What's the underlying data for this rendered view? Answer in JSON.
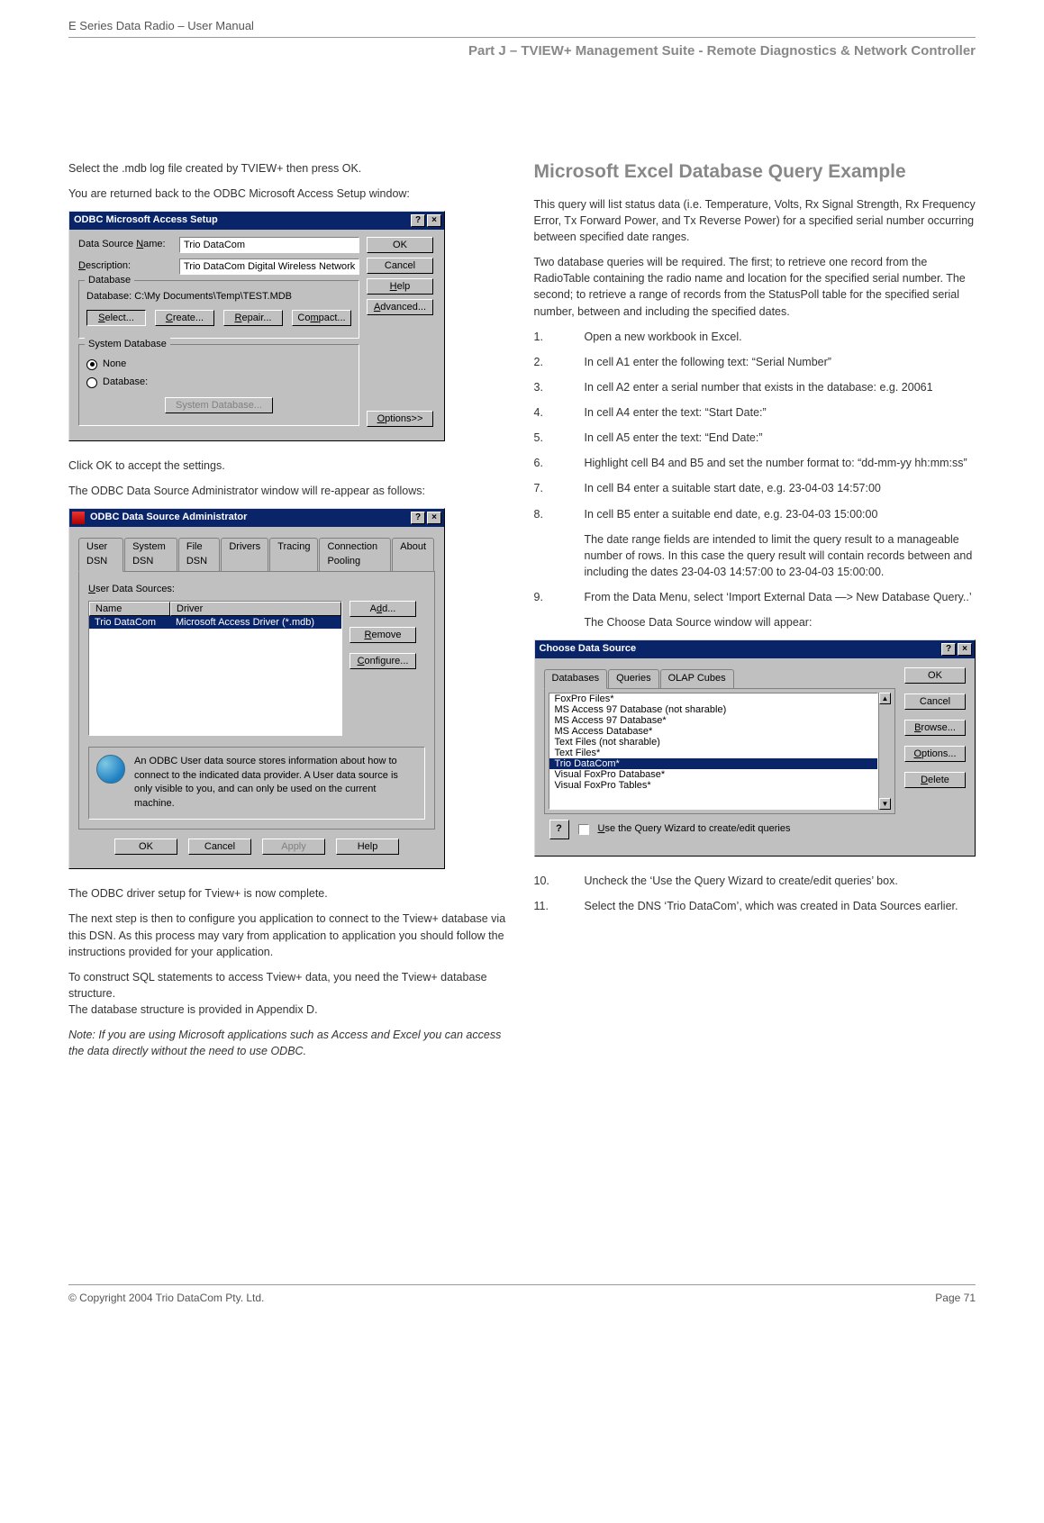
{
  "header": {
    "doc_title": "E Series Data Radio – User Manual",
    "section_title": "Part J – TVIEW+ Management Suite -  Remote Diagnostics & Network Controller"
  },
  "left": {
    "p1": "Select the .mdb log file created by TVIEW+ then press OK.",
    "p2": "You are returned back to the ODBC Microsoft Access Setup window:",
    "p3": "Click OK to accept the settings.",
    "p4": "The ODBC Data Source Administrator window will re-appear as follows:",
    "p5": "The ODBC driver setup for Tview+ is now complete.",
    "p6": "The next step is then to configure you application to connect to the Tview+ database via this DSN.  As this process may vary from application to application you should follow the instructions provided for your application.",
    "p7": "To construct SQL statements to access Tview+ data, you need the Tview+ database structure.",
    "p8": "The database structure is provided in Appendix D.",
    "p9": "Note: If you are using Microsoft applications such as Access and Excel you can access the data directly without the need to use ODBC."
  },
  "dlg1": {
    "title": "ODBC Microsoft Access Setup",
    "help_glyph": "?",
    "close_glyph": "×",
    "lbl_dsn": "Data Source Name:",
    "val_dsn": "Trio DataCom",
    "lbl_desc": "Description:",
    "val_desc": "Trio DataCom Digital Wireless Network Log",
    "grp_db": "Database",
    "db_path": "Database:  C:\\My Documents\\Temp\\TEST.MDB",
    "btn_select": "Select...",
    "btn_create": "Create...",
    "btn_repair": "Repair...",
    "btn_compact": "Compact...",
    "grp_sys": "System Database",
    "radio_none": "None",
    "radio_db": "Database:",
    "btn_sysdb": "System Database...",
    "btn_ok": "OK",
    "btn_cancel": "Cancel",
    "btn_help": "Help",
    "btn_adv": "Advanced...",
    "btn_opt": "Options>>"
  },
  "dlg2": {
    "title": "ODBC Data Source Administrator",
    "help_glyph": "?",
    "close_glyph": "×",
    "tabs": [
      "User DSN",
      "System DSN",
      "File DSN",
      "Drivers",
      "Tracing",
      "Connection Pooling",
      "About"
    ],
    "uds_label": "User Data Sources:",
    "col_name": "Name",
    "col_driver": "Driver",
    "row_name": "Trio DataCom",
    "row_driver": "Microsoft Access Driver (*.mdb)",
    "btn_add": "Add...",
    "btn_remove": "Remove",
    "btn_config": "Configure...",
    "info": "An ODBC User data source stores information about how to connect to the indicated data provider.   A User data source is only visible to you, and can only be used on the current machine.",
    "btn_ok": "OK",
    "btn_cancel": "Cancel",
    "btn_apply": "Apply",
    "btn_help": "Help"
  },
  "right": {
    "h2": "Microsoft Excel Database Query Example",
    "p1": "This query will list status data (i.e. Temperature, Volts, Rx Signal Strength, Rx Frequency Error, Tx Forward Power, and Tx Reverse Power) for a specified serial number occurring between specified date ranges.",
    "p2": "Two database queries will be required.  The first; to retrieve one record from the RadioTable containing the radio name and location for the specified serial number. The second; to retrieve a range of records from the StatusPoll table for the specified serial number, between and including the specified dates.",
    "steps": [
      {
        "n": "1.",
        "t": "Open a new workbook in Excel."
      },
      {
        "n": "2.",
        "t": "In cell A1 enter the following text: “Serial Number”"
      },
      {
        "n": "3.",
        "t": "In cell A2 enter a serial number that exists in the database: e.g. 20061"
      },
      {
        "n": "4.",
        "t": "In cell A4 enter the text: “Start Date:”"
      },
      {
        "n": "5.",
        "t": "In cell A5 enter the text: “End Date:”"
      },
      {
        "n": "6.",
        "t": "Highlight cell B4 and B5 and set the number format to: “dd-mm-yy  hh:mm:ss”"
      },
      {
        "n": "7.",
        "t": "In cell B4 enter a suitable start date, e.g.  23-04-03 14:57:00"
      },
      {
        "n": "8.",
        "t": "In cell B5 enter a suitable end date, e.g.  23-04-03 15:00:00"
      }
    ],
    "step8_extra": "The date range fields are intended to limit the query result to a manageable number of rows.  In this case the query result will contain records between and including the dates 23-04-03 14:57:00 to 23-04-03 15:00:00.",
    "step9_n": "9.",
    "step9_t": "From the Data Menu, select ‘Import External Data —> New Database Query..’",
    "step9_extra": "The Choose Data Source window will appear:",
    "step10_n": "10.",
    "step10_t": "Uncheck the ‘Use the Query Wizard to create/edit queries’ box.",
    "step11_n": "11.",
    "step11_t": "Select the DNS ‘Trio DataCom’, which was created in Data Sources earlier."
  },
  "dlg3": {
    "title": "Choose Data Source",
    "help_glyph": "?",
    "close_glyph": "×",
    "tabs": [
      "Databases",
      "Queries",
      "OLAP Cubes"
    ],
    "items": [
      "FoxPro Files*",
      "MS Access 97 Database (not sharable)",
      "MS Access 97 Database*",
      "MS Access Database*",
      "Text Files (not sharable)",
      "Text Files*",
      "Trio DataCom*",
      "Visual FoxPro Database*",
      "Visual FoxPro Tables*"
    ],
    "selected_index": 6,
    "btn_ok": "OK",
    "btn_cancel": "Cancel",
    "btn_browse": "Browse...",
    "btn_options": "Options...",
    "btn_delete": "Delete",
    "wizard_label": "Use the Query Wizard to create/edit queries",
    "qmark": "?"
  },
  "footer": {
    "left": "© Copyright 2004 Trio DataCom Pty. Ltd.",
    "right": "Page 71"
  }
}
